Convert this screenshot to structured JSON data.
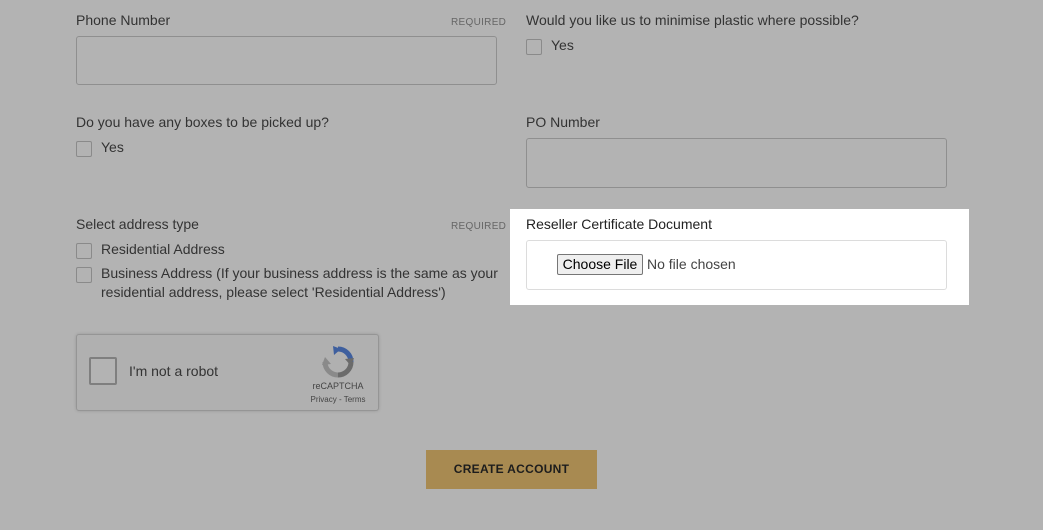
{
  "form": {
    "phone": {
      "label": "Phone Number",
      "required": "REQUIRED",
      "value": ""
    },
    "plastic": {
      "question": "Would you like us to minimise plastic where possible?",
      "option": "Yes",
      "checked": false
    },
    "boxes": {
      "question": "Do you have any boxes to be picked up?",
      "option": "Yes",
      "checked": false
    },
    "po": {
      "label": "PO Number",
      "value": ""
    },
    "address_type": {
      "label": "Select address type",
      "required": "REQUIRED",
      "options": [
        "Residential Address",
        "Business Address (If your business address is the same as your",
        "residential address, please select 'Residential Address')"
      ]
    },
    "reseller": {
      "label": "Reseller Certificate Document",
      "button": "Choose File",
      "status": "No file chosen"
    },
    "recaptcha": {
      "text": "I'm not a robot",
      "brand": "reCAPTCHA",
      "privacy": "Privacy",
      "separator": " - ",
      "terms": "Terms"
    },
    "submit": "CREATE ACCOUNT"
  },
  "colors": {
    "overlay": "#b3b3b3",
    "button": "#a88a51",
    "spotlight": "#ffffff"
  }
}
